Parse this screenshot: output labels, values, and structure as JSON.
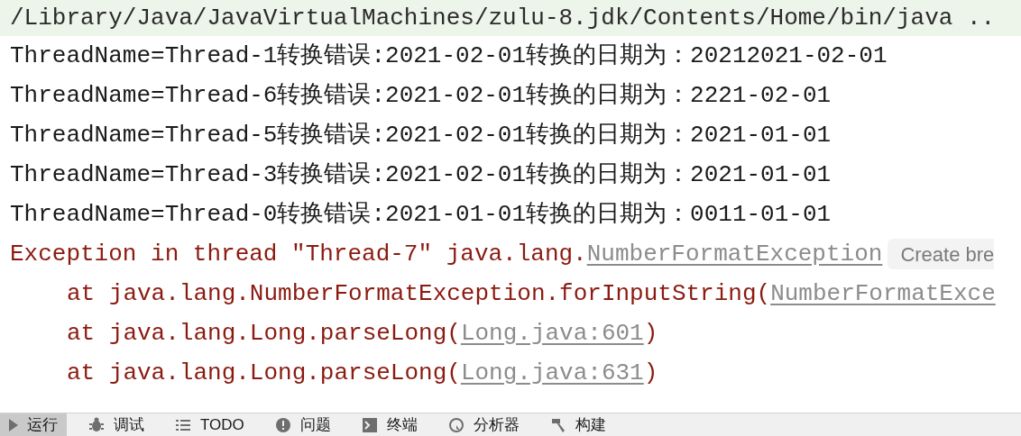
{
  "command": "/Library/Java/JavaVirtualMachines/zulu-8.jdk/Contents/Home/bin/java ..",
  "lines": [
    {
      "indent": false,
      "segments": [
        {
          "kind": "out",
          "text": "ThreadName=Thread-1转换错误:2021-02-01转换的日期为：20212021-02-01"
        }
      ]
    },
    {
      "indent": false,
      "segments": [
        {
          "kind": "out",
          "text": "ThreadName=Thread-6转换错误:2021-02-01转换的日期为：2221-02-01"
        }
      ]
    },
    {
      "indent": false,
      "segments": [
        {
          "kind": "out",
          "text": "ThreadName=Thread-5转换错误:2021-02-01转换的日期为：2021-01-01"
        }
      ]
    },
    {
      "indent": false,
      "segments": [
        {
          "kind": "out",
          "text": "ThreadName=Thread-3转换错误:2021-02-01转换的日期为：2021-01-01"
        }
      ]
    },
    {
      "indent": false,
      "segments": [
        {
          "kind": "out",
          "text": "ThreadName=Thread-0转换错误:2021-01-01转换的日期为：0011-01-01"
        }
      ]
    },
    {
      "indent": false,
      "segments": [
        {
          "kind": "err",
          "text": "Exception in thread \"Thread-7\" java.lang."
        },
        {
          "kind": "link",
          "text": "NumberFormatException"
        },
        {
          "kind": "hint",
          "text": "Create bre"
        }
      ]
    },
    {
      "indent": true,
      "segments": [
        {
          "kind": "err",
          "text": "at java.lang.NumberFormatException.forInputString("
        },
        {
          "kind": "link",
          "text": "NumberFormatExce"
        }
      ]
    },
    {
      "indent": true,
      "segments": [
        {
          "kind": "err",
          "text": "at java.lang.Long.parseLong("
        },
        {
          "kind": "link",
          "text": "Long.java:601"
        },
        {
          "kind": "err",
          "text": ")"
        }
      ]
    },
    {
      "indent": true,
      "segments": [
        {
          "kind": "err",
          "text": "at java.lang.Long.parseLong("
        },
        {
          "kind": "link",
          "text": "Long.java:631"
        },
        {
          "kind": "err",
          "text": ")"
        }
      ]
    }
  ],
  "tabs": [
    {
      "label": "运行",
      "selected": true
    },
    {
      "label": "调试",
      "selected": false
    },
    {
      "label": "TODO",
      "selected": false
    },
    {
      "label": "问题",
      "selected": false
    },
    {
      "label": "终端",
      "selected": false
    },
    {
      "label": "分析器",
      "selected": false
    },
    {
      "label": "构建",
      "selected": false
    }
  ]
}
